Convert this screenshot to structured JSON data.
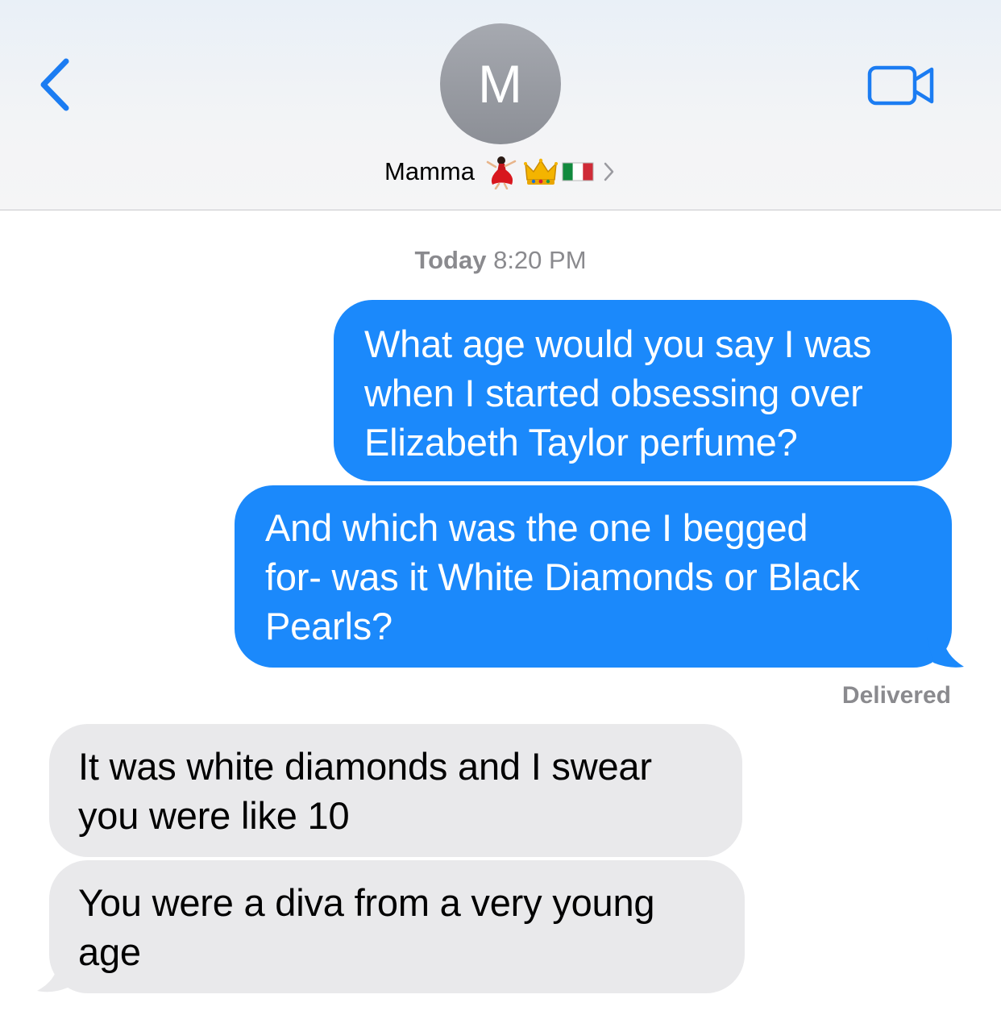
{
  "header": {
    "avatar_initial": "M",
    "contact_name": "Mamma",
    "contact_emojis": [
      "dancer-emoji",
      "crown-emoji",
      "italy-flag-emoji"
    ],
    "back_icon": "chevron-left-icon",
    "video_icon": "video-camera-icon",
    "accent_color": "#1b7cf2"
  },
  "conversation": {
    "timestamp_day": "Today",
    "timestamp_time": "8:20 PM",
    "messages": [
      {
        "direction": "sent",
        "text": "What age would you say I was\nwhen I started obsessing over\nElizabeth Taylor perfume?"
      },
      {
        "direction": "sent",
        "text": "And which was the one I begged\nfor- was it White Diamonds or Black\nPearls?"
      },
      {
        "direction": "received",
        "text": "It was white diamonds and I swear\nyou were like 10"
      },
      {
        "direction": "received",
        "text": "You were a diva from a very young\nage"
      }
    ],
    "status": "Delivered"
  },
  "colors": {
    "sent_bubble": "#1b89fb",
    "received_bubble": "#e9e9eb",
    "meta_text": "#8a8a8e"
  }
}
